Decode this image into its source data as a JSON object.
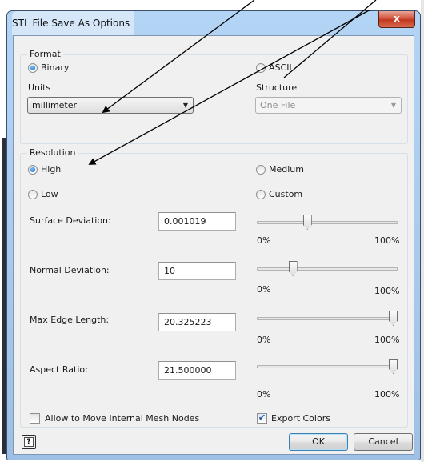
{
  "window": {
    "title": "STL File Save As Options",
    "close_label": "x"
  },
  "format": {
    "group_label": "Format",
    "binary_label": "Binary",
    "binary_selected": true,
    "ascii_label": "ASCII",
    "ascii_selected": false,
    "units_label": "Units",
    "units_value": "millimeter",
    "structure_label": "Structure",
    "structure_value": "One File",
    "structure_enabled": false
  },
  "resolution": {
    "group_label": "Resolution",
    "options": [
      {
        "label": "High",
        "selected": true
      },
      {
        "label": "Medium",
        "selected": false
      },
      {
        "label": "Low",
        "selected": false
      },
      {
        "label": "Custom",
        "selected": false
      }
    ],
    "rows": [
      {
        "label": "Surface Deviation:",
        "value": "0.001019",
        "slider_percent": 35,
        "min_label": "0%",
        "max_label": "100%"
      },
      {
        "label": "Normal Deviation:",
        "value": "10",
        "slider_percent": 24,
        "min_label": "0%",
        "max_label": "100%"
      },
      {
        "label": "Max Edge Length:",
        "value": "20.325223",
        "slider_percent": 100,
        "min_label": "0%",
        "max_label": "100%"
      },
      {
        "label": "Aspect Ratio:",
        "value": "21.500000",
        "slider_percent": 100,
        "min_label": "0%",
        "max_label": "100%"
      }
    ]
  },
  "options": {
    "move_nodes_label": "Allow to Move Internal Mesh Nodes",
    "move_nodes_checked": false,
    "export_colors_label": "Export Colors",
    "export_colors_checked": true
  },
  "footer": {
    "help_label": "?",
    "ok_label": "OK",
    "cancel_label": "Cancel"
  },
  "colors": {
    "annotation_arrows": "#000000",
    "frame_blue": "#a9cbee",
    "close_red": "#c0381d",
    "radio_dot": "#1560c4"
  }
}
